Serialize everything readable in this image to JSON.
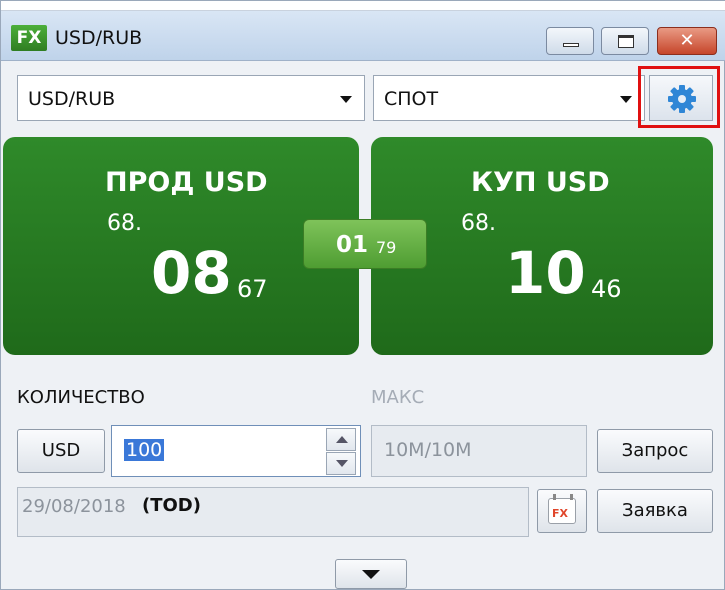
{
  "window": {
    "logo": "FX",
    "title": "USD/RUB"
  },
  "controls": {
    "pair": "USD/RUB",
    "deal_type": "СПОТ",
    "settings_icon": "gear-icon"
  },
  "sell": {
    "title": "ПРОД USD",
    "price_prefix": "68.",
    "price_big": "08",
    "price_pips": "67"
  },
  "buy": {
    "title": "КУП USD",
    "price_prefix": "68.",
    "price_big": "10",
    "price_pips": "46"
  },
  "spread": {
    "main": "01",
    "sub": "79"
  },
  "quantity": {
    "label": "КОЛИЧЕСТВО",
    "currency": "USD",
    "value": "100"
  },
  "max": {
    "label": "МАКС",
    "value": "10M/10M"
  },
  "date": {
    "value": "29/08/2018",
    "tag": "(TOD)"
  },
  "buttons": {
    "request": "Запрос",
    "order": "Заявка"
  },
  "colors": {
    "tile_green": "#2f8a2a",
    "spread_green": "#6ab348",
    "highlight_red": "#e01010"
  }
}
